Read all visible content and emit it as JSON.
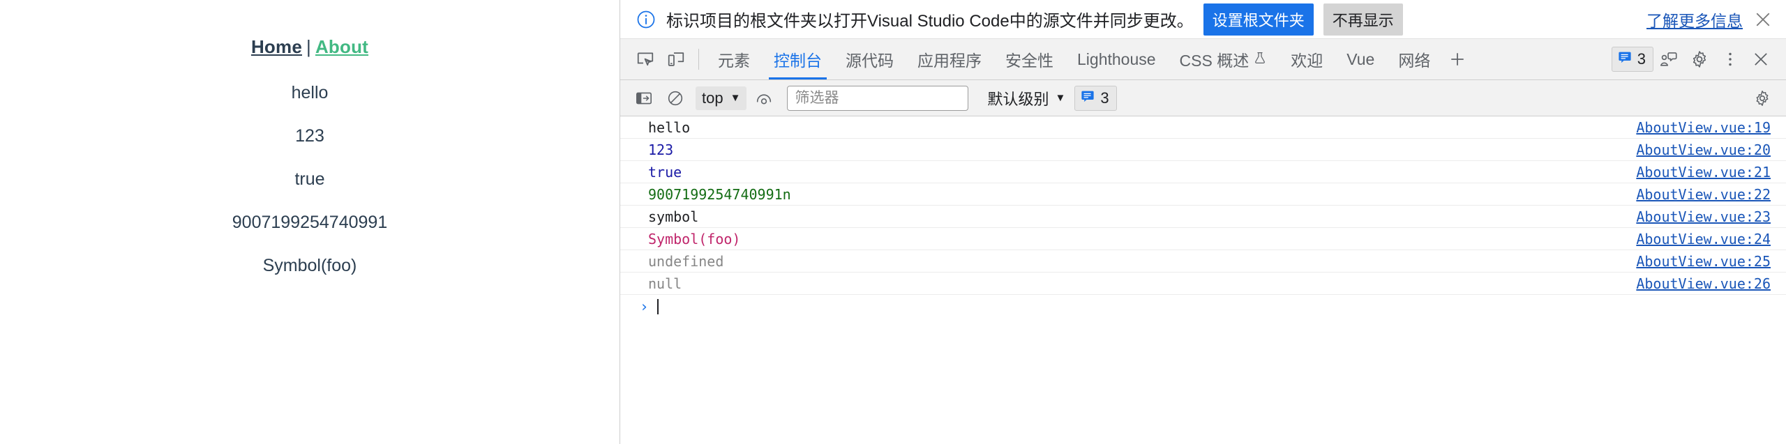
{
  "page": {
    "nav": {
      "home_label": "Home",
      "separator": "|",
      "about_label": "About"
    },
    "lines": [
      "hello",
      "123",
      "true",
      "9007199254740991",
      "Symbol(foo)"
    ],
    "colors": {
      "text": "#2c3e50",
      "active_link": "#42b983"
    }
  },
  "infobar": {
    "icon": "info-circle-icon",
    "message": "标识项目的根文件夹以打开Visual Studio Code中的源文件并同步更改。",
    "primary_button": "设置根文件夹",
    "secondary_button": "不再显示",
    "learn_more": "了解更多信息",
    "close_icon": "close-icon",
    "accent": "#1a73e8"
  },
  "tabbar": {
    "inspect_icon": "inspect-element-icon",
    "device_icon": "device-toolbar-icon",
    "tabs": [
      {
        "label": "元素",
        "selected": false
      },
      {
        "label": "控制台",
        "selected": true
      },
      {
        "label": "源代码",
        "selected": false
      },
      {
        "label": "应用程序",
        "selected": false
      },
      {
        "label": "安全性",
        "selected": false
      },
      {
        "label": "Lighthouse",
        "selected": false
      },
      {
        "label": "CSS 概述",
        "selected": false,
        "icon": "flask-icon"
      },
      {
        "label": "欢迎",
        "selected": false
      },
      {
        "label": "Vue",
        "selected": false
      },
      {
        "label": "网络",
        "selected": false
      }
    ],
    "add_tab_icon": "plus-icon",
    "message_count": "3",
    "message_icon": "message-icon",
    "feedback_icon": "feedback-icon",
    "settings_icon": "gear-icon",
    "more_icon": "kebab-menu-icon",
    "close_icon": "close-icon"
  },
  "console_toolbar": {
    "sidebar_icon": "console-sidebar-icon",
    "clear_icon": "clear-console-icon",
    "context": "top",
    "eye_icon": "live-expression-icon",
    "filter_placeholder": "筛选器",
    "filter_value": "",
    "level": "默认级别",
    "message_count": "3",
    "message_icon": "message-icon",
    "settings_icon": "gear-icon"
  },
  "console": {
    "rows": [
      {
        "text": "hello",
        "type": "string",
        "source": "AboutView.vue:19"
      },
      {
        "text": "123",
        "type": "number",
        "source": "AboutView.vue:20"
      },
      {
        "text": "true",
        "type": "boolean",
        "source": "AboutView.vue:21"
      },
      {
        "text": "9007199254740991n",
        "type": "bigint",
        "source": "AboutView.vue:22"
      },
      {
        "text": "symbol",
        "type": "string",
        "source": "AboutView.vue:23"
      },
      {
        "text": "Symbol(foo)",
        "type": "symbol",
        "source": "AboutView.vue:24"
      },
      {
        "text": "undefined",
        "type": "undefined",
        "source": "AboutView.vue:25"
      },
      {
        "text": "null",
        "type": "null",
        "source": "AboutView.vue:26"
      }
    ],
    "prompt_arrow": "›",
    "prompt_value": ""
  }
}
